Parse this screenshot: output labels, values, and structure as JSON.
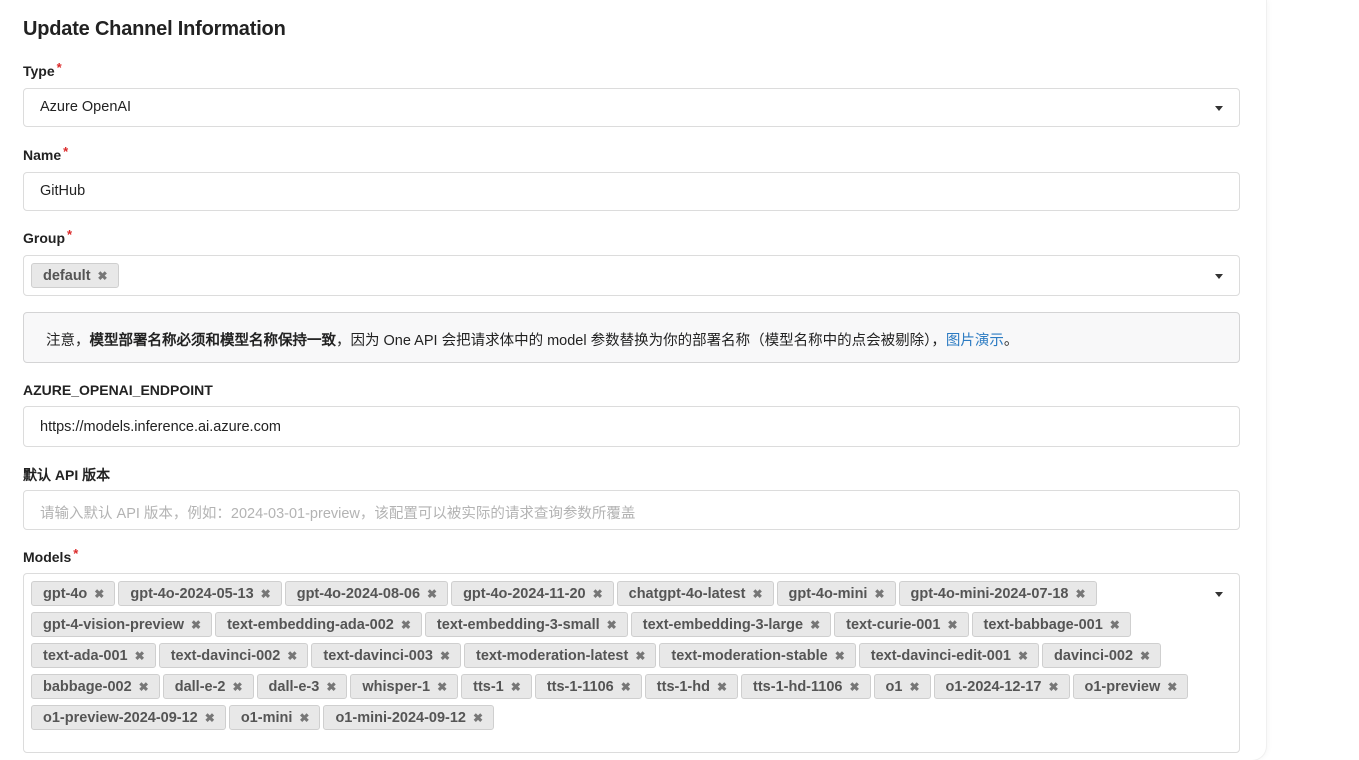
{
  "page": {
    "title": "Update Channel Information"
  },
  "type_field": {
    "label": "Type",
    "required_mark": "*",
    "value": "Azure OpenAI"
  },
  "name_field": {
    "label": "Name",
    "required_mark": "*",
    "value": "GitHub"
  },
  "group_field": {
    "label": "Group",
    "required_mark": "*",
    "chips": [
      "default"
    ]
  },
  "notice": {
    "prefix": "注意，",
    "bold": "模型部署名称必须和模型名称保持一致",
    "middle": "，因为 One API 会把请求体中的 model 参数替换为你的部署名称（模型名称中的点会被剔除），",
    "link": "图片演示",
    "suffix": "。"
  },
  "endpoint_field": {
    "label": "AZURE_OPENAI_ENDPOINT",
    "value": "https://models.inference.ai.azure.com"
  },
  "api_version_field": {
    "label": "默认 API 版本",
    "placeholder": "请输入默认 API 版本，例如：2024-03-01-preview，该配置可以被实际的请求查询参数所覆盖"
  },
  "models_field": {
    "label": "Models",
    "required_mark": "*",
    "chips": [
      "gpt-4o",
      "gpt-4o-2024-05-13",
      "gpt-4o-2024-08-06",
      "gpt-4o-2024-11-20",
      "chatgpt-4o-latest",
      "gpt-4o-mini",
      "gpt-4o-mini-2024-07-18",
      "gpt-4-vision-preview",
      "text-embedding-ada-002",
      "text-embedding-3-small",
      "text-embedding-3-large",
      "text-curie-001",
      "text-babbage-001",
      "text-ada-001",
      "text-davinci-002",
      "text-davinci-003",
      "text-moderation-latest",
      "text-moderation-stable",
      "text-davinci-edit-001",
      "davinci-002",
      "babbage-002",
      "dall-e-2",
      "dall-e-3",
      "whisper-1",
      "tts-1",
      "tts-1-1106",
      "tts-1-hd",
      "tts-1-hd-1106",
      "o1",
      "o1-2024-12-17",
      "o1-preview",
      "o1-preview-2024-09-12",
      "o1-mini",
      "o1-mini-2024-09-12"
    ]
  },
  "icons": {
    "remove": "close-icon",
    "dropdown": "caret-down-icon"
  }
}
